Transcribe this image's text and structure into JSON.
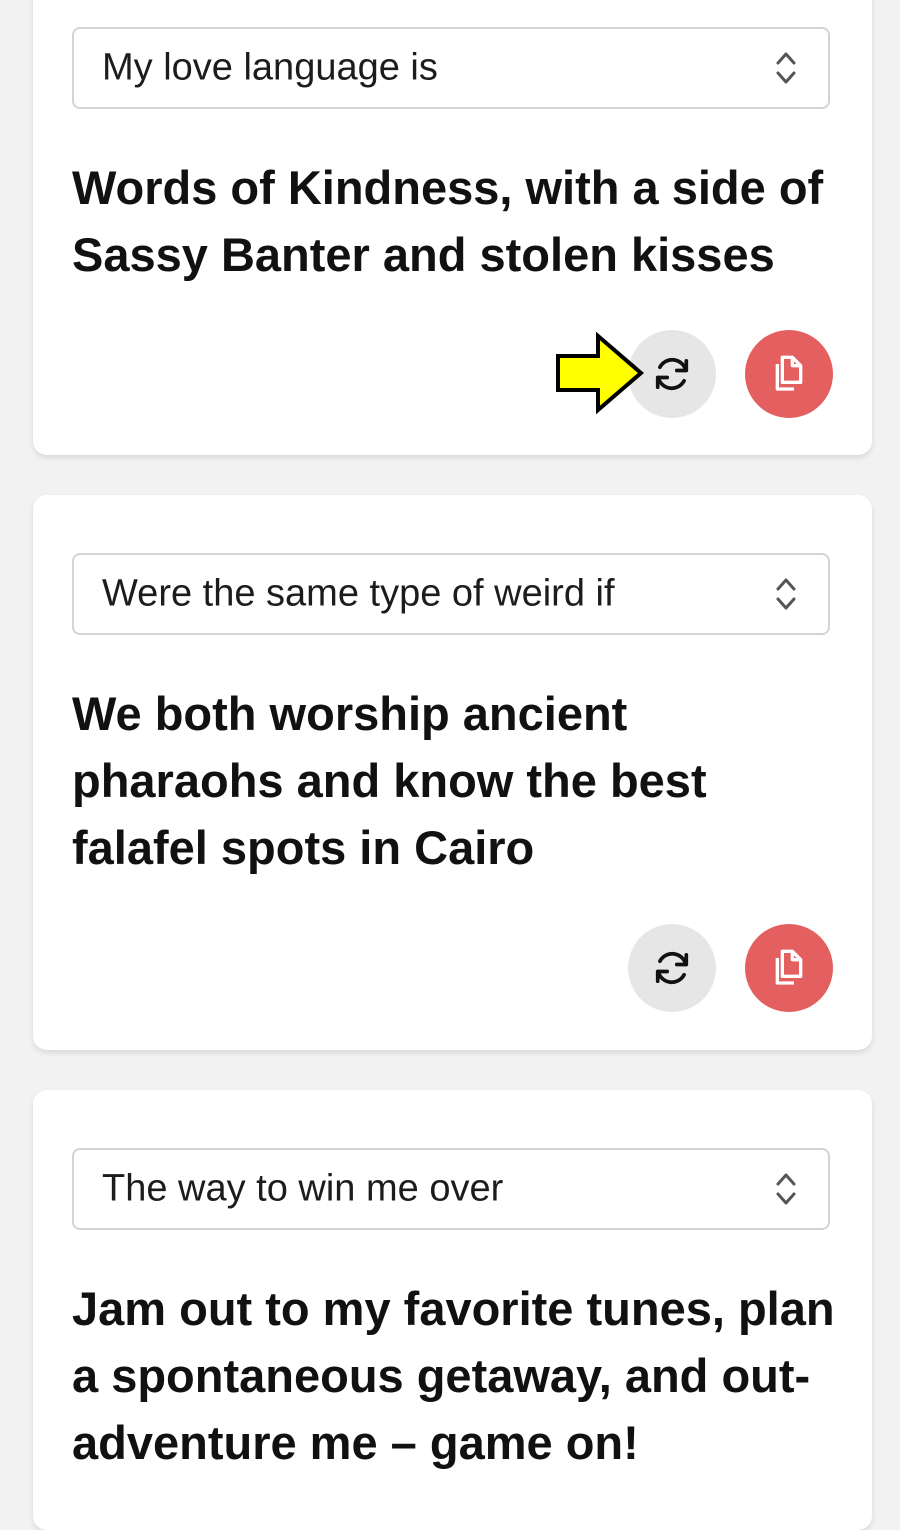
{
  "colors": {
    "page_background": "#f2f2f2",
    "card_background": "#ffffff",
    "refresh_button": "#e6e6e6",
    "copy_button": "#e45f5f",
    "highlight_arrow": "#ffff00"
  },
  "icons": {
    "select": "chevron-up-down-icon",
    "refresh": "refresh-icon",
    "copy": "copy-icon",
    "pointer": "yellow-arrow-icon"
  },
  "cards": [
    {
      "prompt": "My love language is",
      "answer": "Words of Kindness, with a side of Sassy Banter and stolen kisses"
    },
    {
      "prompt": "Were the same type of weird if",
      "answer": "We both worship ancient pharaohs and know the best falafel spots in Cairo"
    },
    {
      "prompt": "The way to win me over",
      "answer": "Jam out to my favorite tunes, plan a spontaneous getaway, and out-adventure me – game on!"
    }
  ]
}
